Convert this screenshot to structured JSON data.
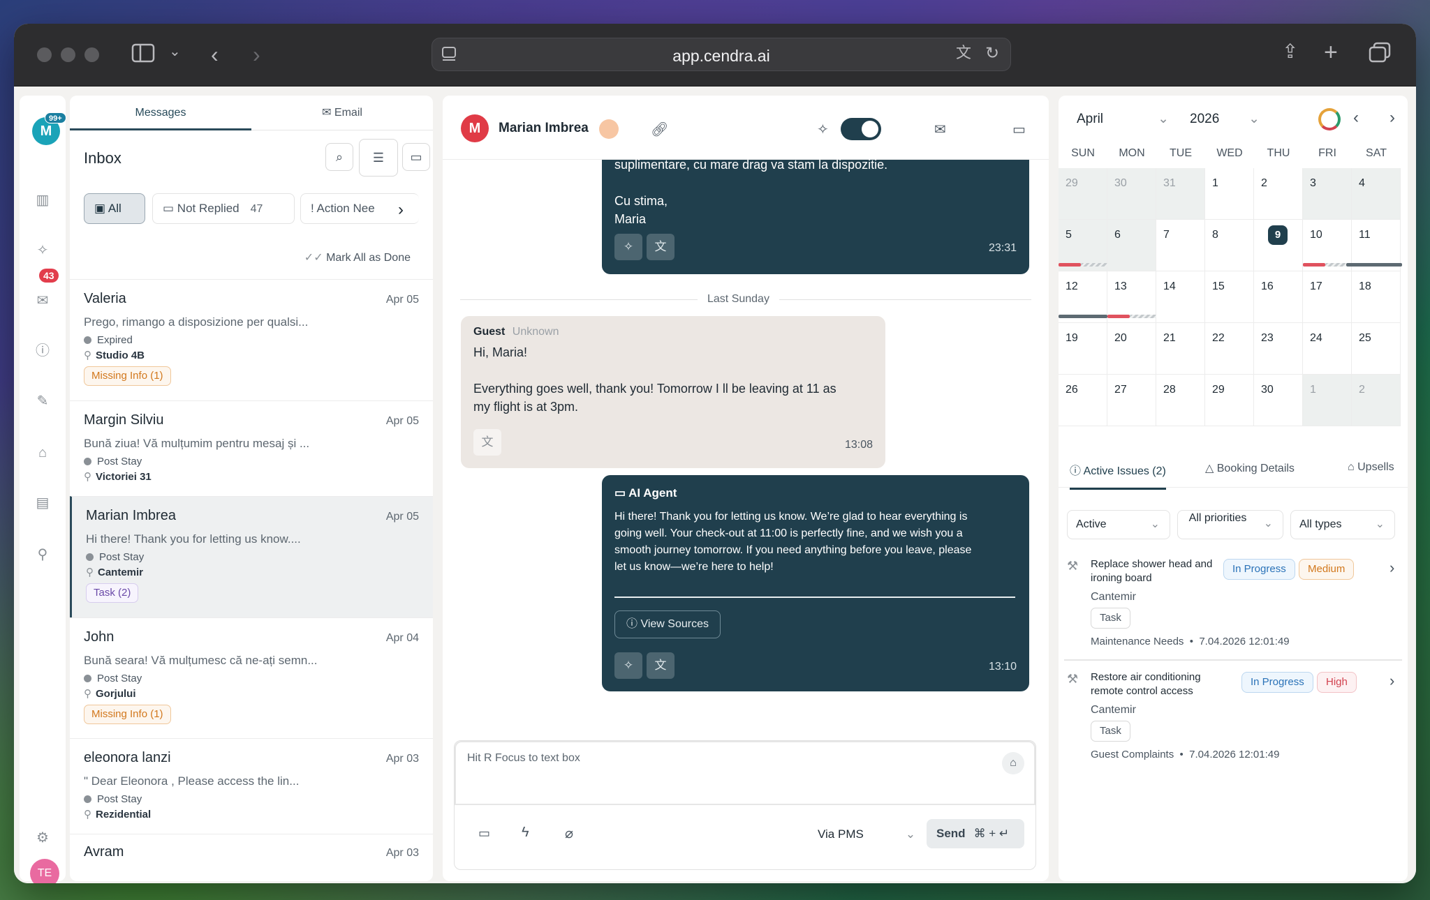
{
  "browser": {
    "url": "app.cendra.ai"
  },
  "rail": {
    "avatar_initial": "M",
    "badge_notifications": "99+",
    "badge_inbox": "43",
    "user_initials": "TE"
  },
  "inbox": {
    "tabs": [
      "Messages",
      "Email"
    ],
    "title": "Inbox",
    "filters": {
      "all": "All",
      "not_replied": "Not Replied",
      "not_replied_count": "47",
      "action_needed": "Action Nee"
    },
    "mark_all_done": "Mark All as Done",
    "conversations": [
      {
        "name": "Valeria",
        "date": "Apr 05",
        "preview": "Prego, rimango a disposizione per qualsi...",
        "status": "Expired",
        "location": "Studio 4B",
        "tag": "Missing Info (1)"
      },
      {
        "name": "Margin Silviu",
        "date": "Apr 05",
        "preview": "Bună ziua! Vă mulțumim pentru mesaj și ...",
        "status": "Post Stay",
        "location": "Victoriei 31",
        "tag": ""
      },
      {
        "name": "Marian Imbrea",
        "date": "Apr 05",
        "preview": "Hi there! Thank you for letting us know....",
        "status": "Post Stay",
        "location": "Cantemir",
        "tag": "Task (2)"
      },
      {
        "name": "John",
        "date": "Apr 04",
        "preview": "Bună seara! Vă mulțumesc că ne-ați semn...",
        "status": "Post Stay",
        "location": "Gorjului",
        "tag": "Missing Info (1)"
      },
      {
        "name": "eleonora lanzi",
        "date": "Apr 03",
        "preview": "\" Dear Eleonora , Please access the lin...",
        "status": "Post Stay",
        "location": "Rezidential",
        "tag": ""
      },
      {
        "name": "Avram",
        "date": "Apr 03",
        "preview": "",
        "status": "",
        "location": "",
        "tag": ""
      }
    ]
  },
  "chat": {
    "contact_initial": "M",
    "contact_name": "Marian Imbrea",
    "msg1": {
      "line1": "suplimentare, cu mare drag va stam la dispozitie.",
      "line2": "Cu stima,",
      "line3": "Maria",
      "time": "23:31"
    },
    "divider": "Last Sunday",
    "msg2": {
      "sender": "Guest",
      "sender_sub": "Unknown",
      "line1": "Hi, Maria!",
      "line2": "Everything goes well, thank you! Tomorrow I ll be leaving at 11 as",
      "line3": "my flight is at 3pm.",
      "time": "13:08"
    },
    "msg3": {
      "sender": "AI Agent",
      "body1": "Hi there! Thank you for letting us know. We’re glad to hear everything is",
      "body2": "going well. Your check-out at 11:00 is perfectly fine, and we wish you a",
      "body3": "smooth journey tomorrow. If you need anything before you leave, please",
      "body4": "let us know—we’re here to help!",
      "view_sources": "View Sources",
      "time": "13:10"
    },
    "composer": {
      "placeholder": "Hit R Focus to text box",
      "channel": "Via PMS",
      "send": "Send",
      "shortcut": "⌘ + ↵"
    }
  },
  "calendar": {
    "month": "April",
    "year": "2026",
    "dow": [
      "SUN",
      "MON",
      "TUE",
      "WED",
      "THU",
      "FRI",
      "SAT"
    ],
    "weeks": [
      [
        "29",
        "30",
        "31",
        "1",
        "2",
        "3",
        "4"
      ],
      [
        "5",
        "6",
        "7",
        "8",
        "9",
        "10",
        "11"
      ],
      [
        "12",
        "13",
        "14",
        "15",
        "16",
        "17",
        "18"
      ],
      [
        "19",
        "20",
        "21",
        "22",
        "23",
        "24",
        "25"
      ],
      [
        "26",
        "27",
        "28",
        "29",
        "30",
        "1",
        "2"
      ]
    ],
    "today": "9"
  },
  "details": {
    "tabs": [
      "Active Issues (2)",
      "Booking Details",
      "Upsells"
    ],
    "filters": [
      "Active",
      "All priorities",
      "All types"
    ],
    "issues": [
      {
        "title": "Replace shower head and ironing board",
        "status": "In Progress",
        "priority": "Medium",
        "location": "Cantemir",
        "type": "Task",
        "category": "Maintenance Needs",
        "timestamp": "7.04.2026 12:01:49"
      },
      {
        "title": "Restore air conditioning remote control access",
        "status": "In Progress",
        "priority": "High",
        "location": "Cantemir",
        "type": "Task",
        "category": "Guest Complaints",
        "timestamp": "7.04.2026 12:01:49"
      }
    ]
  },
  "colors": {
    "primary": "#203f4d",
    "danger": "#e23d4c",
    "warning": "#d2781d",
    "info": "#2b73b8"
  }
}
